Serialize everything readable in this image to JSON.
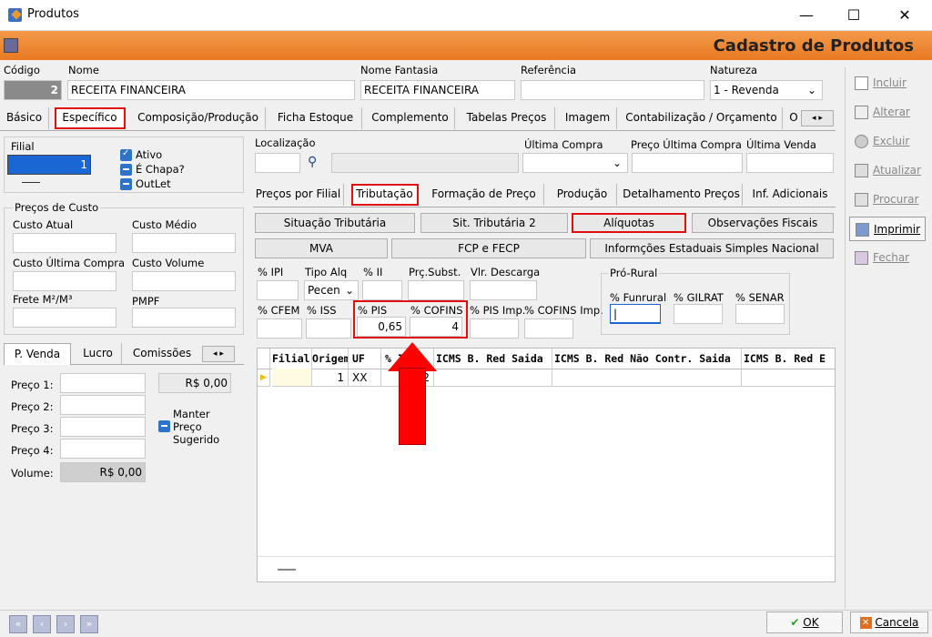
{
  "window": {
    "title": "Produtos",
    "minimize": "—",
    "maximize": "☐",
    "close": "✕"
  },
  "header": {
    "title": "Cadastro de Produtos"
  },
  "top_fields": {
    "codigo_label": "Código",
    "codigo_value": "2",
    "nome_label": "Nome",
    "nome_value": "RECEITA FINANCEIRA",
    "fantasia_label": "Nome Fantasia",
    "fantasia_value": "RECEITA FINANCEIRA",
    "referencia_label": "Referência",
    "referencia_value": "",
    "natureza_label": "Natureza",
    "natureza_value": "1 - Revenda"
  },
  "main_tabs": [
    {
      "label": "Básico"
    },
    {
      "label": "Específico"
    },
    {
      "label": "Composição/Produção"
    },
    {
      "label": "Ficha Estoque"
    },
    {
      "label": "Complemento"
    },
    {
      "label": "Tabelas Preços"
    },
    {
      "label": "Imagem"
    },
    {
      "label": "Contabilização / Orçamento"
    },
    {
      "label": "O"
    }
  ],
  "left": {
    "filial_label": "Filial",
    "filial_value": "1",
    "ativo": "Ativo",
    "chapa": "É Chapa?",
    "outlet": "OutLet",
    "precos_custo": "Preços de Custo",
    "custo_atual": "Custo Atual",
    "custo_medio": "Custo Médio",
    "custo_ultima": "Custo Última Compra",
    "custo_volume": "Custo Volume",
    "frete": "Frete M²/M³",
    "pmpf": "PMPF",
    "tabs": [
      "P. Venda",
      "Lucro",
      "Comissões"
    ],
    "preco1": "Preço 1:",
    "preco2": "Preço 2:",
    "preco3": "Preço 3:",
    "preco4": "Preço 4:",
    "volume": "Volume:",
    "preco1_value": "R$ 0,00",
    "volume_value": "R$ 0,00",
    "manter": "Manter",
    "preco": "Preço",
    "sugerido": "Sugerido"
  },
  "mid": {
    "localizacao": "Localização",
    "ultima_compra": "Última Compra",
    "preco_ultima": "Preço Última Compra",
    "ultima_venda": "Última Venda"
  },
  "sub_tabs": [
    {
      "label": "Preços por Filial"
    },
    {
      "label": "Tributação"
    },
    {
      "label": "Formação de Preço"
    },
    {
      "label": "Produção"
    },
    {
      "label": "Detalhamento Preços"
    },
    {
      "label": "Inf. Adicionais"
    }
  ],
  "trib_buttons": {
    "situacao": "Situação Tributária",
    "sit2": "Sit. Tributária 2",
    "aliquotas": "Alíquotas",
    "obs": "Observações Fiscais",
    "mva": "MVA",
    "fcp": "FCP e FECP",
    "info_est": "Informções Estaduais Simples Nacional"
  },
  "aliq": {
    "ipi": "% IPI",
    "tipo_alq": "Tipo Alq",
    "ii": "% II",
    "prc_subst": "Prç.Subst.",
    "vlr_descarga": "Vlr. Descarga",
    "tipo_alq_value": "Pecen",
    "cfem": "% CFEM",
    "iss": "% ISS",
    "pis": "% PIS",
    "cofins": "% COFINS",
    "pis_imp": "% PIS Imp.",
    "cofins_imp": "% COFINS Imp.",
    "pis_value": "0,65",
    "cofins_value": "4",
    "pro_rural": "Pró-Rural",
    "funrural": "% Funrural",
    "gilrat": "% GILRAT",
    "senar": "% SENAR"
  },
  "grid": {
    "headers": [
      "Filial",
      "Origem",
      "UF",
      "% I",
      "ICMS B. Red Saida",
      "ICMS B. Red Não Contr. Saida",
      "ICMS B. Red E"
    ],
    "row": {
      "origem": "1",
      "uf": "XX",
      "ii": "2"
    }
  },
  "sidebar": {
    "incluir": "Incluir",
    "alterar": "Alterar",
    "excluir": "Excluir",
    "atualizar": "Atualizar",
    "procurar": "Procurar",
    "imprimir": "Imprimir",
    "fechar": "Fechar"
  },
  "footer": {
    "ok": "OK",
    "cancela": "Cancela"
  }
}
